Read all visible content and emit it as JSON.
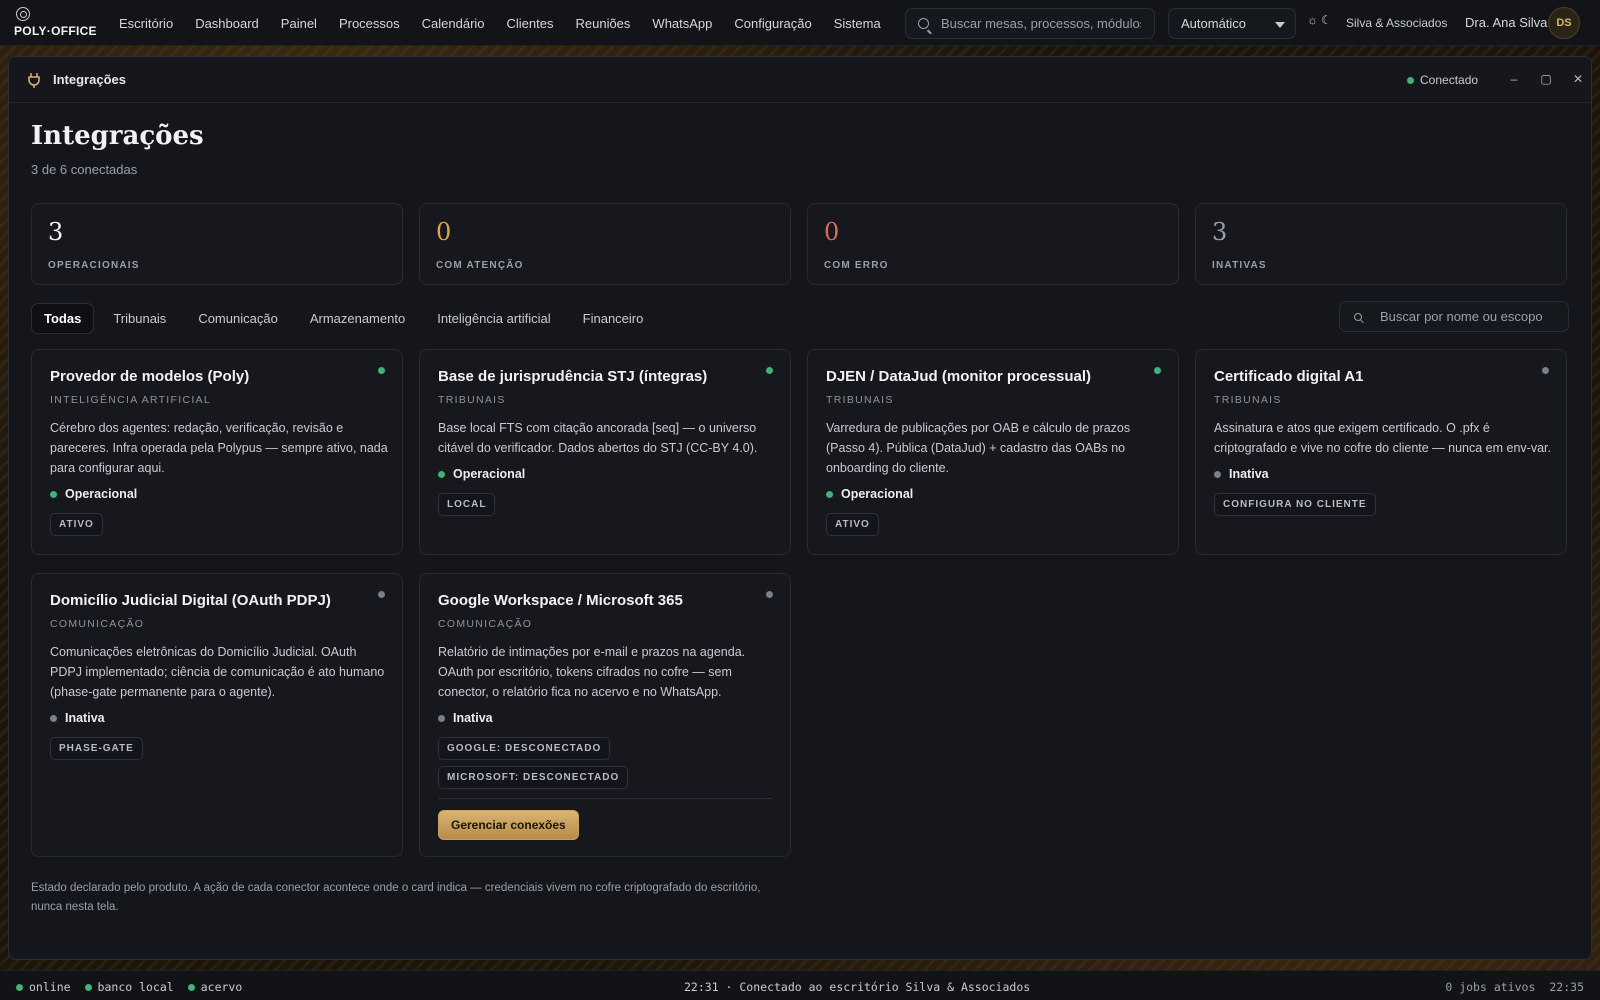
{
  "app": {
    "logo_text": "POLY·OFFICE"
  },
  "nav": {
    "items": [
      "Escritório",
      "Dashboard",
      "Painel",
      "Processos",
      "Calendário",
      "Clientes",
      "Reuniões",
      "WhatsApp",
      "Configuração",
      "Sistema"
    ]
  },
  "search": {
    "placeholder": "Buscar mesas, processos, módulos"
  },
  "mode_select": {
    "value": "Automático"
  },
  "theme_icons": {
    "light": "☼",
    "dark": "☾"
  },
  "office": {
    "name": "Silva & Associados"
  },
  "user": {
    "name": "Dra. Ana Silva",
    "initials": "DS"
  },
  "window": {
    "title": "Integrações",
    "connection_status": "Conectado",
    "controls": {
      "minimize": "–",
      "maximize": "▢",
      "close": "✕"
    }
  },
  "page": {
    "title": "Integrações",
    "subtitle": "3 de 6 conectadas"
  },
  "stats": [
    {
      "value": "3",
      "label": "OPERACIONAIS",
      "color": "#f1f2f4"
    },
    {
      "value": "0",
      "label": "COM ATENÇÃO",
      "color": "#d9a64a"
    },
    {
      "value": "0",
      "label": "COM ERRO",
      "color": "#d86b5b"
    },
    {
      "value": "3",
      "label": "INATIVAS",
      "color": "#9aa0a8"
    }
  ],
  "tabs": [
    "Todas",
    "Tribunais",
    "Comunicação",
    "Armazenamento",
    "Inteligência artificial",
    "Financeiro"
  ],
  "active_tab": "Todas",
  "filter_search": {
    "placeholder": "Buscar por nome ou escopo"
  },
  "cards": [
    {
      "title": "Provedor de modelos (Poly)",
      "category": "INTELIGÊNCIA ARTIFICIAL",
      "description": "Cérebro dos agentes: redação, verificação, revisão e pareceres. Infra operada pela Polypus — sempre ativo, nada para configurar aqui.",
      "status": "Operacional",
      "status_color": "green",
      "tags": [
        "ATIVO"
      ]
    },
    {
      "title": "Base de jurisprudência STJ (íntegras)",
      "category": "TRIBUNAIS",
      "description": "Base local FTS com citação ancorada [seq] — o universo citável do verificador. Dados abertos do STJ (CC-BY 4.0).",
      "status": "Operacional",
      "status_color": "green",
      "tags": [
        "LOCAL"
      ]
    },
    {
      "title": "DJEN / DataJud (monitor processual)",
      "category": "TRIBUNAIS",
      "description": "Varredura de publicações por OAB e cálculo de prazos (Passo 4). Pública (DataJud) + cadastro das OABs no onboarding do cliente.",
      "status": "Operacional",
      "status_color": "green",
      "tags": [
        "ATIVO"
      ]
    },
    {
      "title": "Certificado digital A1",
      "category": "TRIBUNAIS",
      "description": "Assinatura e atos que exigem certificado. O .pfx é criptografado e vive no cofre do cliente — nunca em env-var.",
      "status": "Inativa",
      "status_color": "gray",
      "tags": [
        "CONFIGURA NO CLIENTE"
      ]
    },
    {
      "title": "Domicílio Judicial Digital (OAuth PDPJ)",
      "category": "COMUNICAÇÃO",
      "description": "Comunicações eletrônicas do Domicílio Judicial. OAuth PDPJ implementado; ciência de comunicação é ato humano (phase-gate permanente para o agente).",
      "status": "Inativa",
      "status_color": "gray",
      "tags": [
        "PHASE-GATE"
      ]
    },
    {
      "title": "Google Workspace / Microsoft 365",
      "category": "COMUNICAÇÃO",
      "description": "Relatório de intimações por e-mail e prazos na agenda. OAuth por escritório, tokens cifrados no cofre — sem conector, o relatório fica no acervo e no WhatsApp.",
      "status": "Inativa",
      "status_color": "gray",
      "tags": [
        "GOOGLE: DESCONECTADO",
        "MICROSOFT: DESCONECTADO"
      ],
      "action_label": "Gerenciar conexões"
    }
  ],
  "footnote": "Estado declarado pelo produto. A ação de cada conector acontece onde o card indica — credenciais vivem no cofre criptografado do escritório, nunca nesta tela.",
  "statusbar": {
    "left": [
      "online",
      "banco local",
      "acervo"
    ],
    "center": "22:31 · Conectado ao escritório Silva & Associados",
    "jobs": "0 jobs ativos",
    "time": "22:35"
  },
  "colors": {
    "accent_gold": "#d9b473",
    "status_green": "#3fb37a",
    "status_gray": "#7a7f88"
  }
}
